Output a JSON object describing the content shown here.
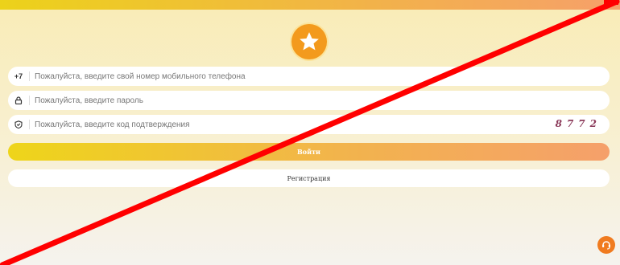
{
  "colors": {
    "accent": "#f39a1d",
    "overlay_line": "#ff0000"
  },
  "logo": {
    "icon": "star-icon"
  },
  "form": {
    "phone": {
      "prefix": "+7",
      "placeholder": "Пожалуйста, введите свой номер мобильного телефона"
    },
    "password": {
      "icon": "lock-icon",
      "placeholder": "Пожалуйста, введите пароль"
    },
    "code": {
      "icon": "shield-icon",
      "placeholder": "Пожалуйста, введите код подтверждения",
      "captcha": "8772"
    }
  },
  "buttons": {
    "login": "Войти",
    "register": "Регистрация"
  },
  "support": {
    "icon": "chat-support-icon"
  }
}
